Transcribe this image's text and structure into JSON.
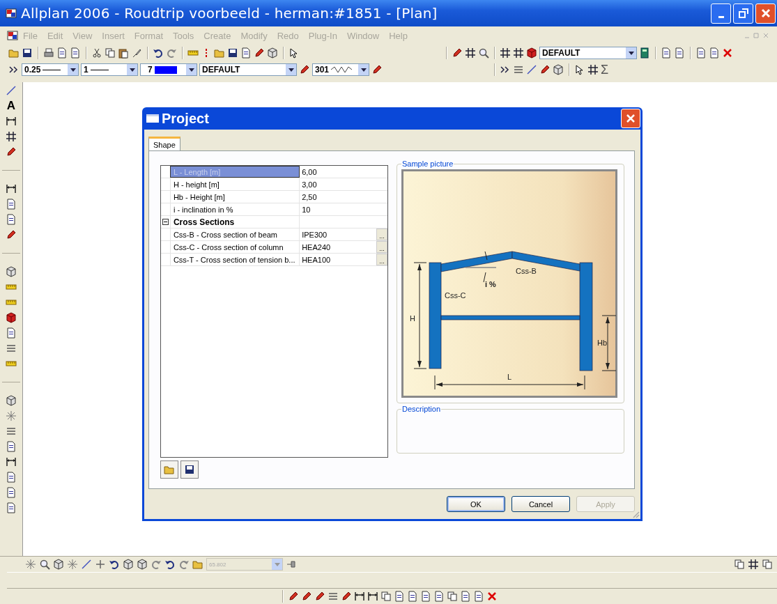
{
  "window": {
    "title": "Allplan 2006 - Roudtrip voorbeeld - herman:#1851 - [Plan]"
  },
  "menu": [
    {
      "label": "File",
      "disabled": true
    },
    {
      "label": "Edit",
      "disabled": true
    },
    {
      "label": "View",
      "disabled": true
    },
    {
      "label": "Insert",
      "disabled": true
    },
    {
      "label": "Format",
      "disabled": true
    },
    {
      "label": "Tools",
      "disabled": true
    },
    {
      "label": "Create",
      "disabled": true
    },
    {
      "label": "Modify",
      "disabled": true
    },
    {
      "label": "Redo",
      "disabled": true
    },
    {
      "label": "Plug-In",
      "disabled": true
    },
    {
      "label": "Window",
      "disabled": true
    },
    {
      "label": "Help",
      "disabled": true
    }
  ],
  "toolbar": {
    "layer": "DEFAULT"
  },
  "format_bar": {
    "pen": "0.25",
    "line": "1",
    "pen_number": "7",
    "layer": "DEFAULT",
    "hatch": "301",
    "sum": "Σ"
  },
  "left_toolbar": {
    "text_tool": "A"
  },
  "dialog": {
    "title": "Project",
    "tabs": [
      {
        "label": "Shape",
        "selected": true
      }
    ],
    "properties": [
      {
        "kind": "property",
        "label": "L - Length [m]",
        "value": "6,00",
        "selected": true,
        "browse": false
      },
      {
        "kind": "property",
        "label": "H - height [m]",
        "value": "3,00",
        "selected": false,
        "browse": false
      },
      {
        "kind": "property",
        "label": "Hb - Height [m]",
        "value": "2,50",
        "selected": false,
        "browse": false
      },
      {
        "kind": "property",
        "label": "i - inclination in %",
        "value": "10",
        "selected": false,
        "browse": false
      },
      {
        "kind": "category",
        "label": "Cross Sections",
        "expanded": true
      },
      {
        "kind": "property",
        "label": "Css-B - Cross section of beam",
        "value": "IPE300",
        "selected": false,
        "browse": true
      },
      {
        "kind": "property",
        "label": "Css-C - Cross section of column",
        "value": "HEA240",
        "selected": false,
        "browse": true
      },
      {
        "kind": "property",
        "label": "Css-T - Cross section of tension b...",
        "value": "HEA100",
        "selected": false,
        "browse": true
      }
    ],
    "browse_label": "...",
    "sample_picture": {
      "title": "Sample picture",
      "beam": "Css-B",
      "column": "Css-C",
      "inclination": "i %",
      "height": "H",
      "brace_height": "Hb",
      "length": "L"
    },
    "description": {
      "title": "Description"
    },
    "buttons": [
      {
        "label": "OK",
        "default": true,
        "disabled": false
      },
      {
        "label": "Cancel",
        "default": false,
        "disabled": false
      },
      {
        "label": "Apply",
        "default": false,
        "disabled": true
      }
    ]
  },
  "view_bar": {
    "zoom": "65.802",
    "zoom_disabled": true
  }
}
